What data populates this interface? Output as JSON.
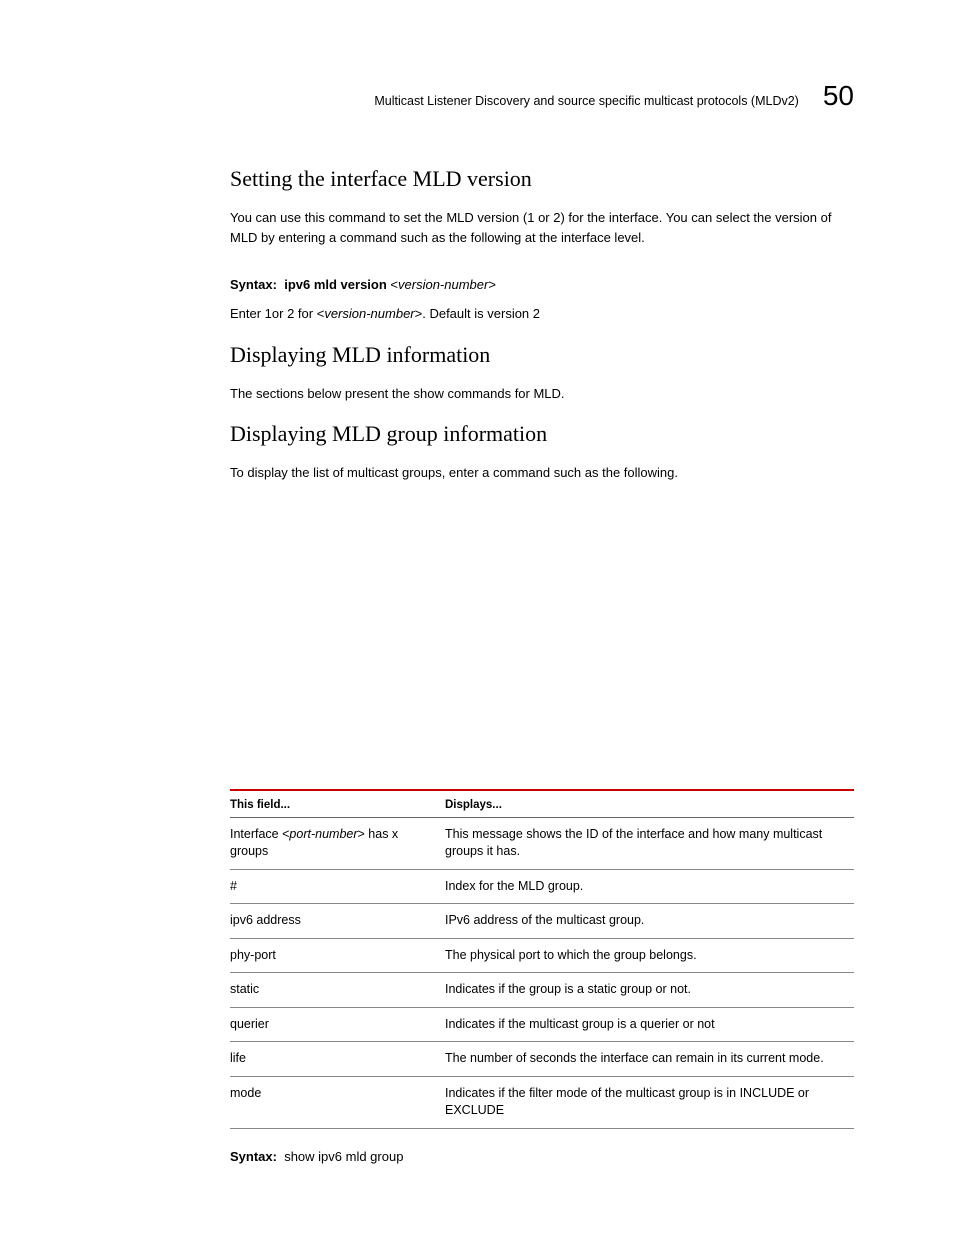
{
  "header": {
    "running_title": "Multicast Listener Discovery and source specific multicast protocols (MLDv2)",
    "chapter_number": "50"
  },
  "sections": {
    "s1": {
      "heading": "Setting the interface MLD version",
      "para": "You can use this command to set the MLD version (1 or 2) for the interface. You can select the version of MLD by entering a command such as the following at the interface level.",
      "syntax_label": "Syntax:",
      "syntax_cmd": "ipv6 mld version",
      "syntax_arg_open": " <",
      "syntax_arg": "version-number",
      "syntax_arg_close": ">",
      "note_prefix": "Enter 1or 2 for <",
      "note_arg": "version-number",
      "note_suffix": ">. Default is version 2"
    },
    "s2": {
      "heading": "Displaying MLD information",
      "para": "The sections below present the show commands for MLD."
    },
    "s3": {
      "heading": "Displaying MLD group information",
      "para": "To display the list of multicast groups, enter a command such as the following."
    }
  },
  "table": {
    "head_field": "This field...",
    "head_displays": "Displays...",
    "rows": [
      {
        "field_pre": "Interface <",
        "field_arg": "port-number",
        "field_post": "> has x groups",
        "desc": "This message shows the ID of the interface and how many multicast groups it has."
      },
      {
        "field": "#",
        "desc": "Index for the MLD group."
      },
      {
        "field": "ipv6 address",
        "desc": "IPv6 address of the multicast group."
      },
      {
        "field": "phy-port",
        "desc": "The physical port to which the group belongs."
      },
      {
        "field": "static",
        "desc": "Indicates if the group is a static group or not."
      },
      {
        "field": "querier",
        "desc": "Indicates if the multicast group is a querier or not"
      },
      {
        "field": "life",
        "desc": "The number of seconds the interface can remain in its current mode."
      },
      {
        "field": "mode",
        "desc": "Indicates if the filter mode of the multicast group is in INCLUDE or EXCLUDE"
      }
    ]
  },
  "footer_syntax": {
    "label": "Syntax:",
    "cmd": "show ipv6 mld group"
  }
}
